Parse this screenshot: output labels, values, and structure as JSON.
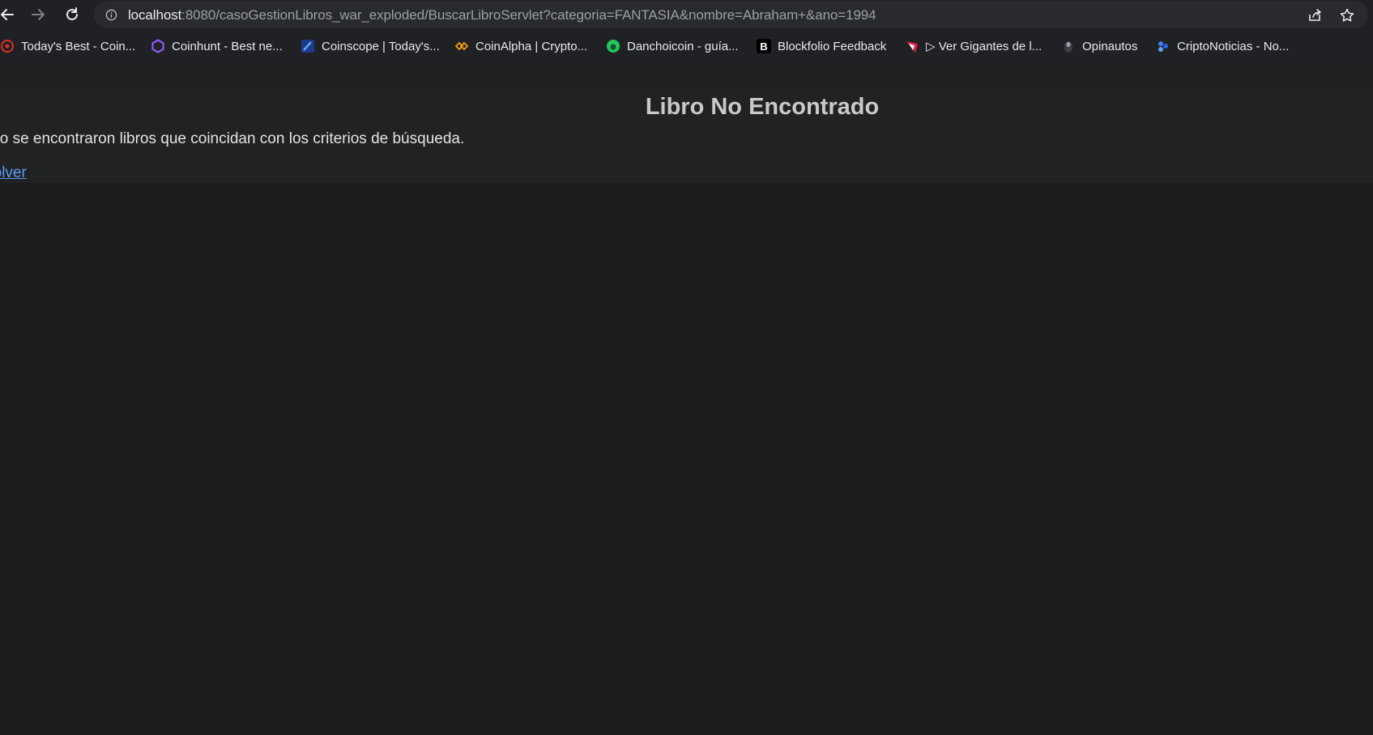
{
  "browser": {
    "url": {
      "host": "localhost",
      "rest": ":8080/casoGestionLibros_war_exploded/BuscarLibroServlet?categoria=FANTASIA&nombre=Abraham+&ano=1994"
    },
    "bookmarks": [
      {
        "label": "Today's Best - Coin...",
        "icon": "red-circle-icon",
        "color": "#d93025"
      },
      {
        "label": "Coinhunt - Best ne...",
        "icon": "purple-hexagon-icon",
        "color": "#8b5cf6"
      },
      {
        "label": "Coinscope | Today's...",
        "icon": "coinscope-icon",
        "color": "#3b82f6"
      },
      {
        "label": "CoinAlpha | Crypto...",
        "icon": "coinalpha-icon",
        "color": "#f59e0b"
      },
      {
        "label": "Danchoicoin - guía...",
        "icon": "green-circle-icon",
        "color": "#22c55e"
      },
      {
        "label": "Blockfolio Feedback",
        "icon": "blockfolio-icon",
        "color": "#000000"
      },
      {
        "label": "▷ Ver Gigantes de l...",
        "icon": "gigantes-icon",
        "color": "#e11d48"
      },
      {
        "label": "Opinautos",
        "icon": "opinautos-icon",
        "color": "#9ca3af"
      },
      {
        "label": "CriptoNoticias - No...",
        "icon": "criptonoticias-icon",
        "color": "#3b82f6"
      }
    ]
  },
  "page": {
    "title": "Libro No Encontrado",
    "message": "No se encontraron libros que coincidan con los criterios de búsqueda.",
    "back_link": "Volver"
  }
}
